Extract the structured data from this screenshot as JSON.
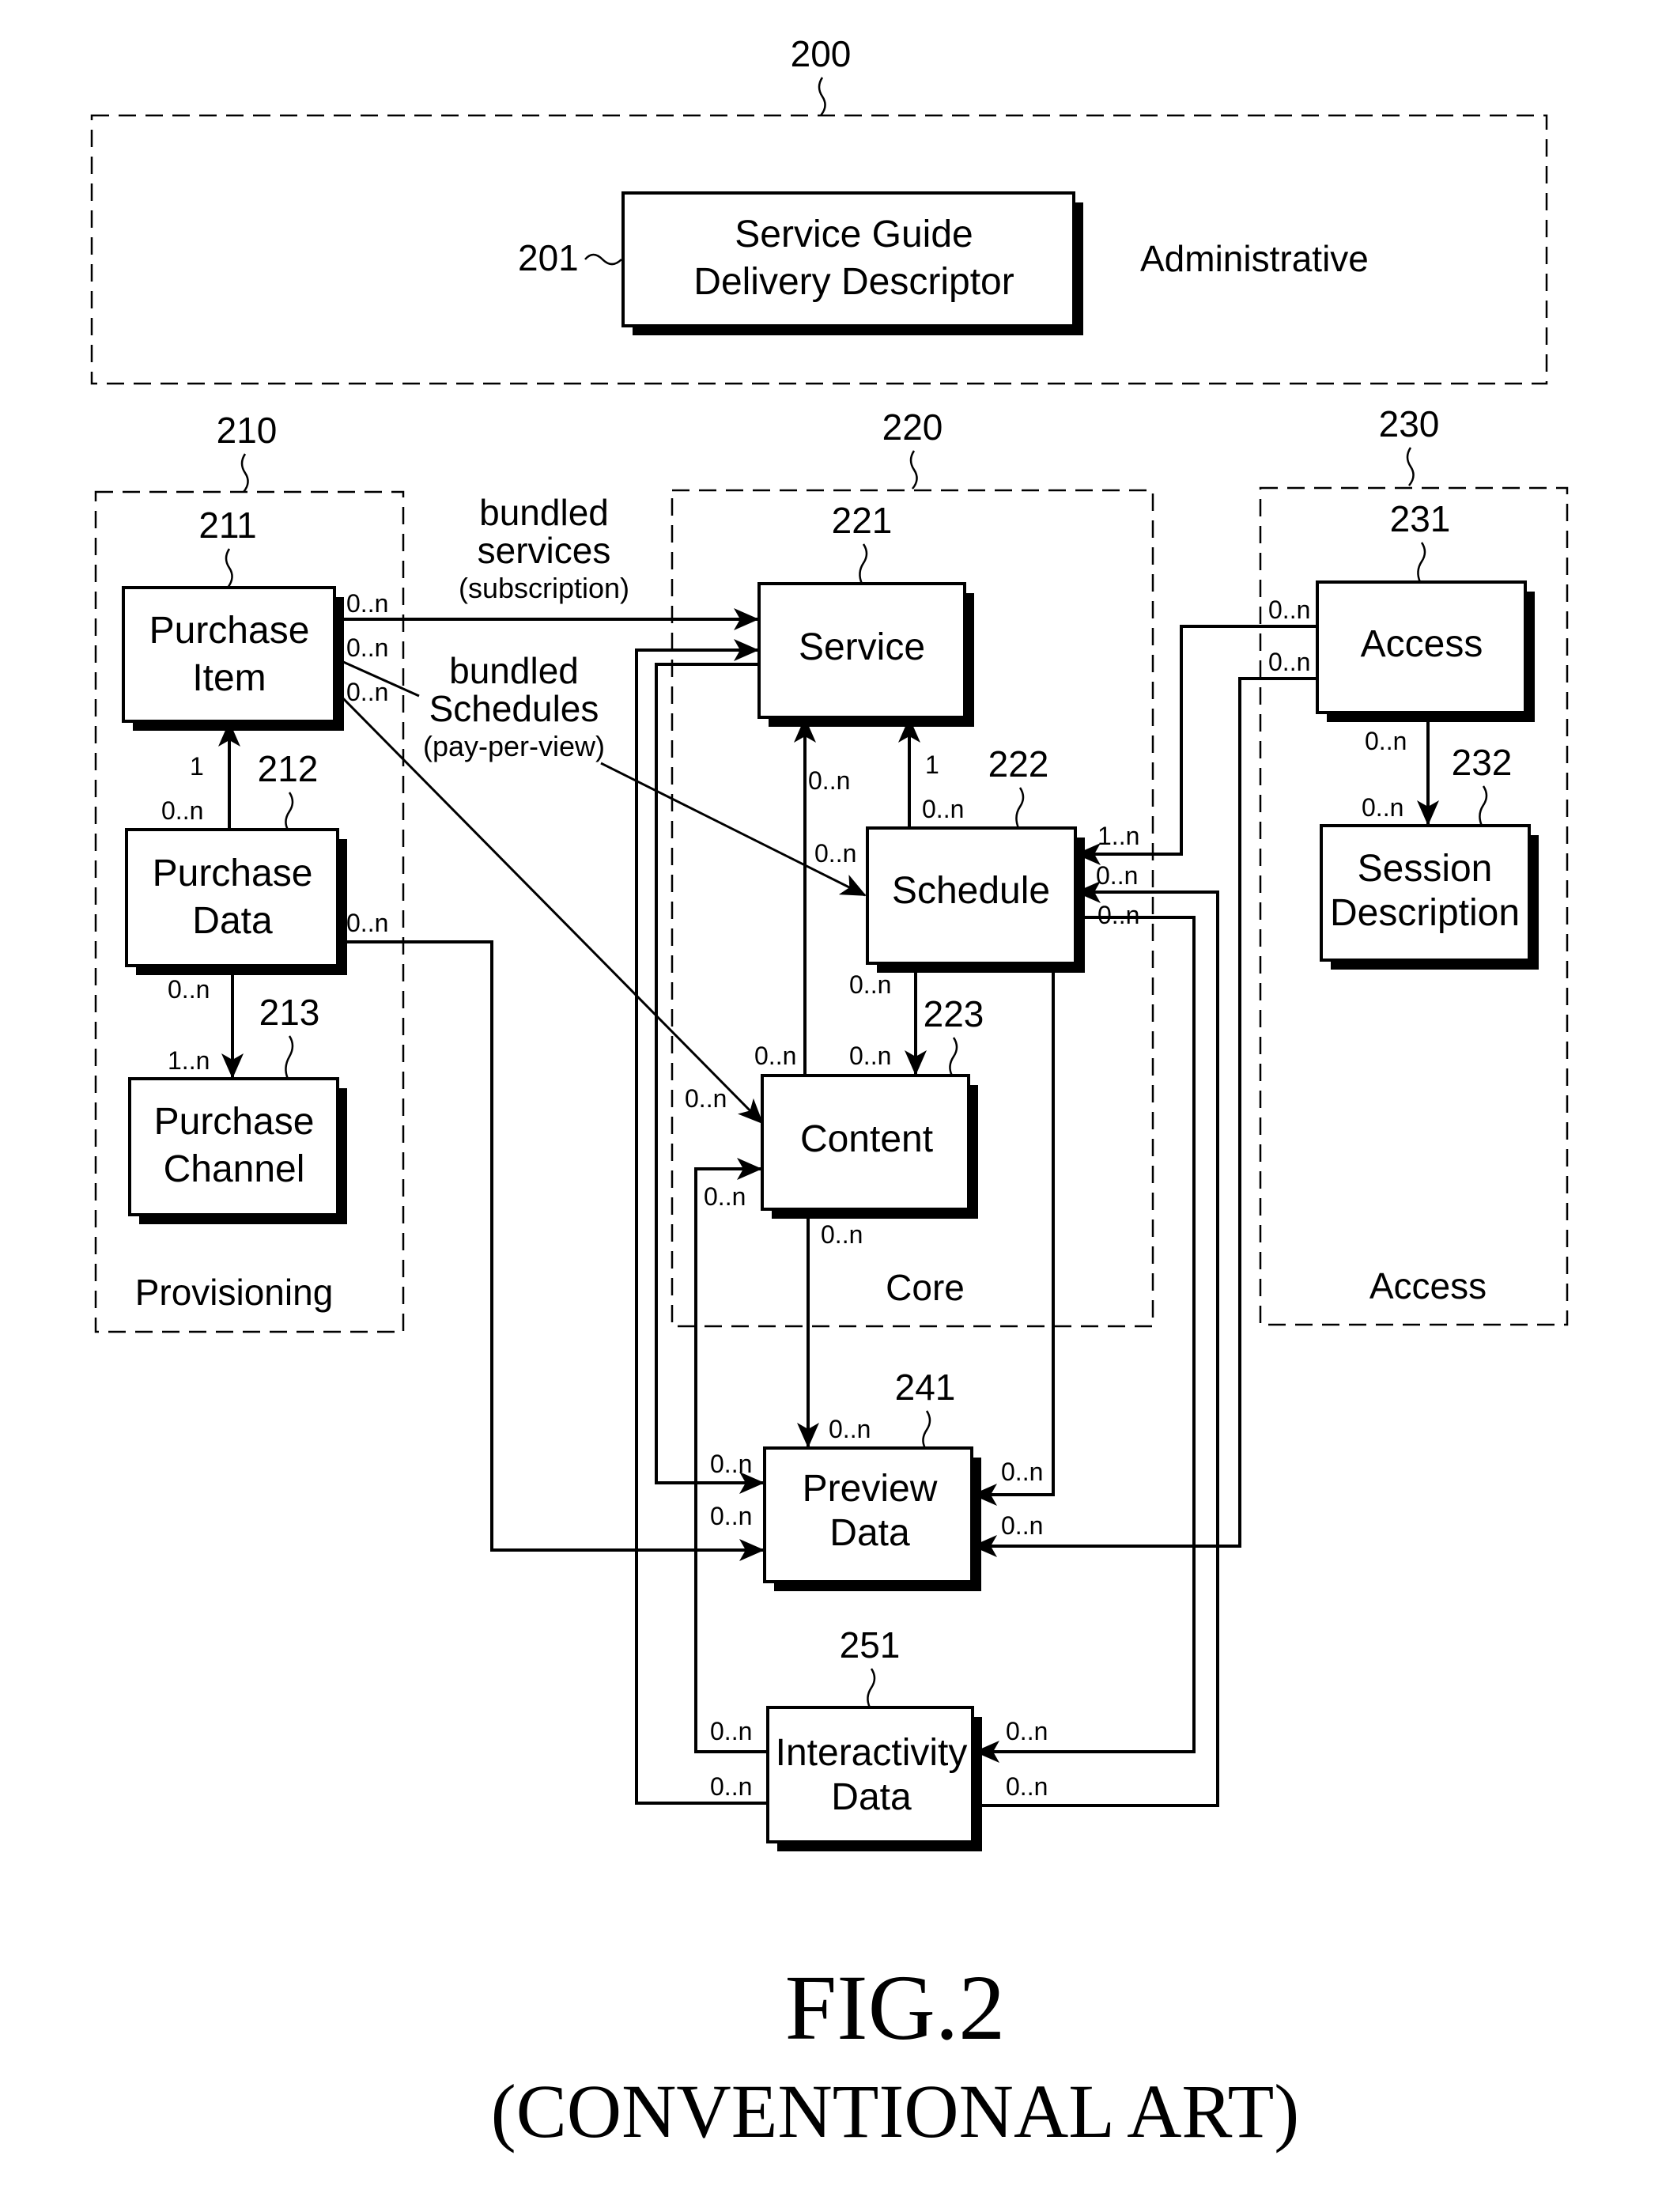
{
  "figure": {
    "title": "FIG.2",
    "subtitle": "(CONVENTIONAL ART)"
  },
  "groups": {
    "administrative": {
      "ref": "200",
      "label": "Administrative"
    },
    "provisioning": {
      "ref": "210",
      "label": "Provisioning"
    },
    "core": {
      "ref": "220",
      "label": "Core"
    },
    "access": {
      "ref": "230",
      "label": "Access"
    }
  },
  "boxes": {
    "sgdd": {
      "ref": "201",
      "line1": "Service Guide",
      "line2": "Delivery Descriptor"
    },
    "purchase_item": {
      "ref": "211",
      "line1": "Purchase",
      "line2": "Item"
    },
    "purchase_data": {
      "ref": "212",
      "line1": "Purchase",
      "line2": "Data"
    },
    "purchase_channel": {
      "ref": "213",
      "line1": "Purchase",
      "line2": "Channel"
    },
    "service": {
      "ref": "221",
      "line1": "Service"
    },
    "schedule": {
      "ref": "222",
      "line1": "Schedule"
    },
    "content": {
      "ref": "223",
      "line1": "Content"
    },
    "access": {
      "ref": "231",
      "line1": "Access"
    },
    "session_description": {
      "ref": "232",
      "line1": "Session",
      "line2": "Description"
    },
    "preview_data": {
      "ref": "241",
      "line1": "Preview",
      "line2": "Data"
    },
    "interactivity_data": {
      "ref": "251",
      "line1": "Interactivity",
      "line2": "Data"
    }
  },
  "annotations": {
    "bundled_services": {
      "line1": "bundled",
      "line2": "services",
      "line3": "(subscription)"
    },
    "bundled_schedules": {
      "line1": "bundled",
      "line2": "Schedules",
      "line3": "(pay-per-view)"
    }
  },
  "multiplicities": {
    "pi_service": "0..n",
    "pi_schedule": "0..n",
    "pi_content": "0..n",
    "pd_pi_top": "1",
    "pd_pi_bottom": "0..n",
    "pd_preview": "0..n",
    "pd_pc_top": "0..n",
    "pd_pc_bottom": "1..n",
    "content_service": "0..n",
    "schedule_service_top": "1",
    "schedule_service_bottom": "0..n",
    "schedule_in": "0..n",
    "schedule_content_top": "0..n",
    "schedule_content_bottom": "0..n",
    "content_top_left": "0..n",
    "content_in_pi": "0..n",
    "content_in_interact": "0..n",
    "content_preview": "0..n",
    "access_top": "0..n",
    "access_bottom": "0..n",
    "access_session_top": "0..n",
    "access_session_bottom": "0..n",
    "schedule_right_1": "1..n",
    "schedule_right_2": "0..n",
    "schedule_right_3": "0..n",
    "preview_top": "0..n",
    "preview_left_1": "0..n",
    "preview_left_2": "0..n",
    "preview_right_1": "0..n",
    "preview_right_2": "0..n",
    "interact_left_1": "0..n",
    "interact_left_2": "0..n",
    "interact_right_1": "0..n",
    "interact_right_2": "0..n"
  }
}
